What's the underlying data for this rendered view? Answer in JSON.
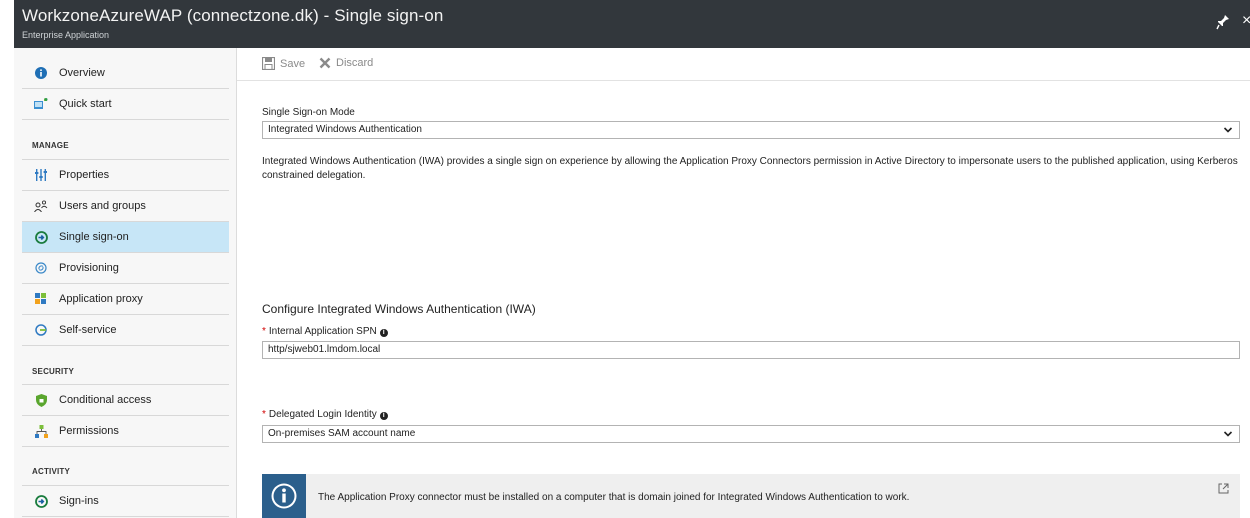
{
  "header": {
    "title": "WorkzoneAzureWAP (connectzone.dk) - Single sign-on",
    "subtitle": "Enterprise Application",
    "close": "×"
  },
  "sidebar": {
    "items": [
      {
        "label": "Overview",
        "icon": "info-icon"
      },
      {
        "label": "Quick start",
        "icon": "quick-start-icon"
      }
    ],
    "manage_label": "MANAGE",
    "manage_items": [
      {
        "label": "Properties",
        "icon": "properties-icon"
      },
      {
        "label": "Users and groups",
        "icon": "users-icon"
      },
      {
        "label": "Single sign-on",
        "icon": "sso-icon",
        "active": true
      },
      {
        "label": "Provisioning",
        "icon": "provisioning-icon"
      },
      {
        "label": "Application proxy",
        "icon": "app-proxy-icon"
      },
      {
        "label": "Self-service",
        "icon": "self-service-icon"
      }
    ],
    "security_label": "SECURITY",
    "security_items": [
      {
        "label": "Conditional access",
        "icon": "shield-icon"
      },
      {
        "label": "Permissions",
        "icon": "permissions-icon"
      }
    ],
    "activity_label": "ACTIVITY",
    "activity_items": [
      {
        "label": "Sign-ins",
        "icon": "sign-ins-icon"
      }
    ]
  },
  "toolbar": {
    "save_label": "Save",
    "discard_label": "Discard"
  },
  "form": {
    "mode_label": "Single Sign-on Mode",
    "mode_value": "Integrated Windows Authentication",
    "description": "Integrated Windows Authentication (IWA) provides a single sign on experience by allowing the Application Proxy Connectors permission in Active Directory to impersonate users to the published application, using Kerberos constrained delegation.",
    "section_title": "Configure Integrated Windows Authentication (IWA)",
    "spn_label": "Internal Application SPN",
    "spn_value": "http/sjweb01.lmdom.local",
    "identity_label": "Delegated Login Identity",
    "identity_value": "On-premises SAM account name",
    "required_mark": "*"
  },
  "notice": {
    "text": "The Application Proxy connector must be installed on a computer that is domain joined for Integrated Windows Authentication to work."
  },
  "colors": {
    "titlebar": "#32373c",
    "active_nav": "#c7e6f7",
    "notice_icon_bg": "#2b5f8c"
  }
}
